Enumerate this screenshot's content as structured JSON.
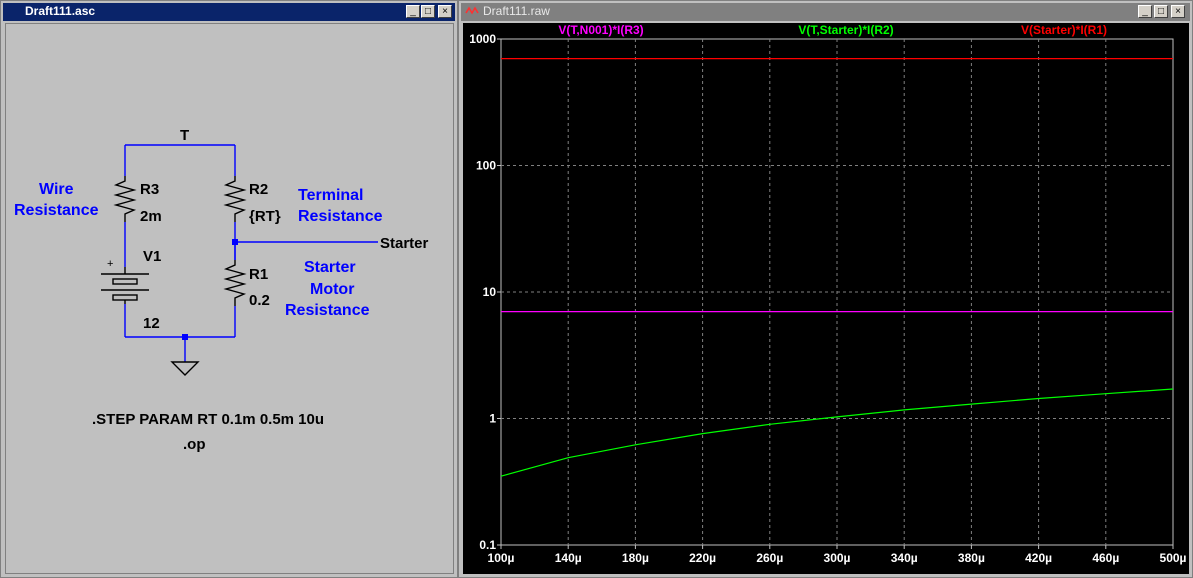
{
  "schematic_window": {
    "title": "Draft111.asc",
    "buttons": {
      "minimize": "_",
      "maximize": "□",
      "close": "×"
    },
    "net_label_top": "T",
    "net_label_starter": "Starter",
    "components": {
      "r3": {
        "name": "R3",
        "value": "2m"
      },
      "r2": {
        "name": "R2",
        "value": "{RT}"
      },
      "r1": {
        "name": "R1",
        "value": "0.2"
      },
      "v1": {
        "name": "V1",
        "value": "12",
        "plus": "+"
      }
    },
    "comments": {
      "wire_line1": "Wire",
      "wire_line2": "Resistance",
      "terminal_line1": "Terminal",
      "terminal_line2": "Resistance",
      "starter_line1": "Starter",
      "starter_line2": "Motor",
      "starter_line3": "Resistance"
    },
    "directives": {
      "step": ".STEP PARAM RT 0.1m 0.5m 10u",
      "op": ".op"
    },
    "colors": {
      "wire": "#0000ff",
      "component": "#000000",
      "comment": "#0000ff",
      "junction": "#0000ff"
    }
  },
  "plot_window": {
    "title": "Draft111.raw",
    "buttons": {
      "minimize": "_",
      "maximize": "□",
      "close": "×"
    },
    "colors": {
      "background": "#000000",
      "axis_text": "#ffffff",
      "grid": "#808080"
    }
  },
  "chart_data": {
    "type": "line",
    "x_scale": "linear",
    "y_scale": "log",
    "xlim": [
      0.0001,
      0.0005
    ],
    "ylim": [
      0.1,
      1000
    ],
    "x_ticks": [
      0.0001,
      0.00014,
      0.00018,
      0.00022,
      0.00026,
      0.0003,
      0.00034,
      0.00038,
      0.00042,
      0.00046,
      0.0005
    ],
    "x_tick_labels": [
      "100µ",
      "140µ",
      "180µ",
      "220µ",
      "260µ",
      "300µ",
      "340µ",
      "380µ",
      "420µ",
      "460µ",
      "500µ"
    ],
    "y_ticks": [
      0.1,
      1,
      10,
      100,
      1000
    ],
    "y_tick_labels": [
      "0.1",
      "1",
      "10",
      "100",
      "1000"
    ],
    "grid": true,
    "legend": "top",
    "series": [
      {
        "name": "V(T,N001)*I(R3)",
        "color": "#ff00ff",
        "x": [
          0.0001,
          0.0005
        ],
        "y": [
          7.0,
          7.0
        ]
      },
      {
        "name": "V(T,Starter)*I(R2)",
        "color": "#00ff00",
        "x": [
          0.0001,
          0.00014,
          0.00018,
          0.00022,
          0.00026,
          0.0003,
          0.00034,
          0.00038,
          0.00042,
          0.00046,
          0.0005
        ],
        "y": [
          0.35,
          0.49,
          0.62,
          0.76,
          0.9,
          1.03,
          1.17,
          1.3,
          1.44,
          1.57,
          1.71
        ]
      },
      {
        "name": "V(Starter)*I(R1)",
        "color": "#ff0000",
        "x": [
          0.0001,
          0.0005
        ],
        "y": [
          700,
          700
        ]
      }
    ]
  }
}
